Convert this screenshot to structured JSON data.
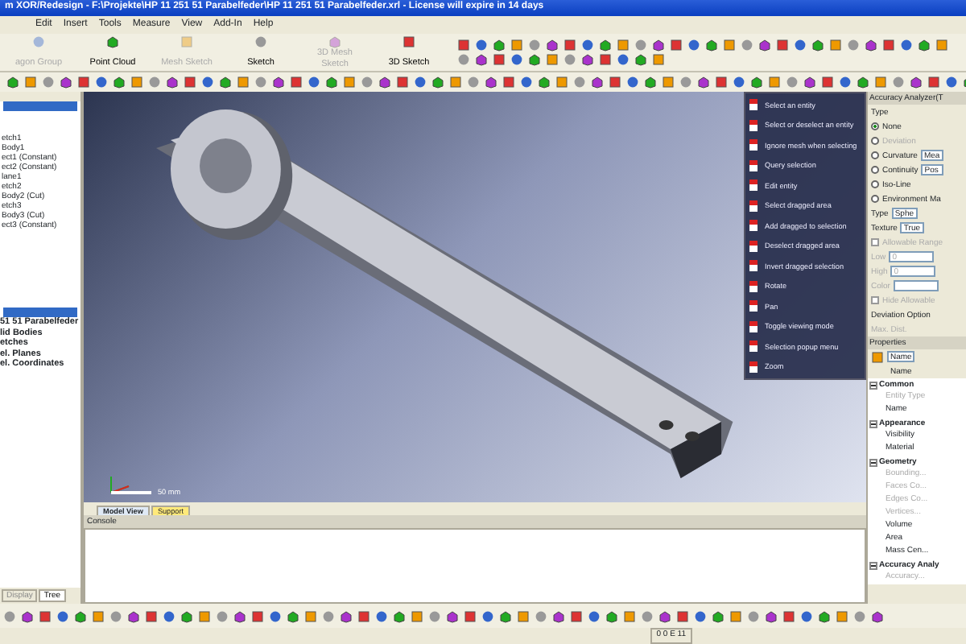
{
  "window": {
    "title": "m XOR/Redesign - F:\\Projekte\\HP 11 251 51 Parabelfeder\\HP 11 251 51 Parabelfeder.xrl - License will expire in 14 days"
  },
  "menu": [
    "Edit",
    "Insert",
    "Tools",
    "Measure",
    "View",
    "Add-In",
    "Help"
  ],
  "toolbar_buttons": [
    {
      "label": "agon Group",
      "disabled": true
    },
    {
      "label": "Point Cloud",
      "disabled": false
    },
    {
      "label": "Mesh Sketch",
      "disabled": true
    },
    {
      "label": "Sketch",
      "disabled": false
    },
    {
      "label": "3D Mesh Sketch",
      "disabled": true
    },
    {
      "label": "3D Sketch",
      "disabled": false
    }
  ],
  "feature_tree": [
    "etch1",
    "Body1",
    "ect1 (Constant)",
    "ect2 (Constant)",
    "lane1",
    "etch2",
    "Body2 (Cut)",
    "etch3",
    "Body3 (Cut)",
    "ect3 (Constant)"
  ],
  "model_tree": [
    "51 51 Parabelfeder",
    "lid Bodies",
    "etches",
    "el. Planes",
    "el. Coordinates"
  ],
  "left_tabs": [
    {
      "label": "Display",
      "selected": false
    },
    {
      "label": "Tree",
      "selected": true
    }
  ],
  "context_menu": [
    "Select an entity",
    "Select or deselect an entity",
    "Ignore mesh when selecting",
    "Query selection",
    "Edit entity",
    "Select dragged area",
    "Add dragged to selection",
    "Deselect dragged area",
    "Invert dragged selection",
    "Rotate",
    "Pan",
    "Toggle viewing mode",
    "Selection popup menu",
    "Zoom"
  ],
  "scale_label": "50 mm",
  "view_tabs": [
    {
      "label": "Model View",
      "selected": true
    },
    {
      "label": "Support",
      "selected": false
    }
  ],
  "console": {
    "title": "Console"
  },
  "accuracy_analyzer": {
    "title": "Accuracy Analyzer(T",
    "group": "Type",
    "options": [
      {
        "label": "None",
        "selected": true,
        "disabled": false
      },
      {
        "label": "Deviation",
        "selected": false,
        "disabled": true
      },
      {
        "label": "Curvature",
        "selected": false,
        "disabled": false,
        "value": "Mea"
      },
      {
        "label": "Continuity",
        "selected": false,
        "disabled": false,
        "value": "Pos"
      },
      {
        "label": "Iso-Line",
        "selected": false,
        "disabled": false
      },
      {
        "label": "Environment Ma",
        "selected": false,
        "disabled": false
      }
    ],
    "fields": [
      {
        "label": "Type",
        "value": "Sphe"
      },
      {
        "label": "Texture",
        "value": "True"
      }
    ],
    "allowable_range": {
      "label": "Allowable Range",
      "checked": false
    },
    "range_fields": [
      {
        "label": "Low",
        "value": "0"
      },
      {
        "label": "High",
        "value": "0"
      },
      {
        "label": "Color"
      }
    ],
    "hide_allowable": {
      "label": "Hide Allowable",
      "checked": false
    },
    "deviation_option": "Deviation Option",
    "max_dist": "Max. Dist."
  },
  "properties": {
    "title": "Properties",
    "sort_label": "Name",
    "column": "Name",
    "groups": [
      {
        "name": "Common",
        "expanded": true,
        "rows": [
          {
            "label": "Entity Type",
            "disabled": true
          },
          {
            "label": "Name",
            "disabled": false
          }
        ]
      },
      {
        "name": "Appearance",
        "expanded": true,
        "rows": [
          {
            "label": "Visibility",
            "disabled": false
          },
          {
            "label": "Material",
            "disabled": false
          }
        ]
      },
      {
        "name": "Geometry",
        "expanded": true,
        "rows": [
          {
            "label": "Bounding...",
            "disabled": true
          },
          {
            "label": "Faces Co...",
            "disabled": true
          },
          {
            "label": "Edges Co...",
            "disabled": true
          },
          {
            "label": "Vertices...",
            "disabled": true
          },
          {
            "label": "Volume",
            "disabled": false
          },
          {
            "label": "Area",
            "disabled": false
          },
          {
            "label": "Mass Cen...",
            "disabled": false
          }
        ]
      },
      {
        "name": "Accuracy Analy",
        "expanded": true,
        "rows": [
          {
            "label": "Accuracy...",
            "disabled": true
          }
        ]
      }
    ]
  },
  "status": "0 0 E 11"
}
